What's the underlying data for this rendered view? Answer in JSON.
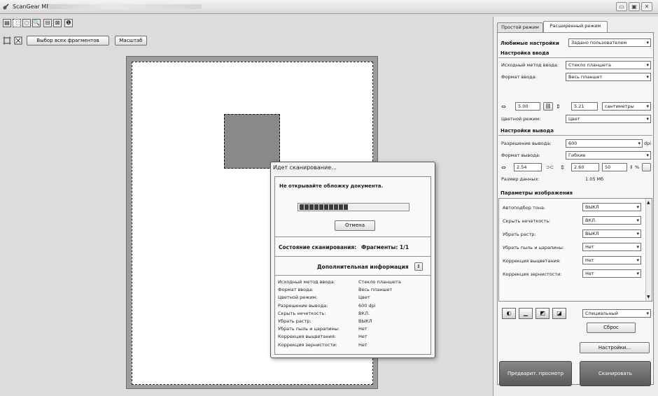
{
  "window": {
    "title": "ScanGear MF",
    "buttons": [
      "▭",
      "▣",
      "✕"
    ]
  },
  "toolbar": {
    "icons": [
      "▤",
      "⬚",
      "◌",
      "🔍",
      "⊟",
      "⊠",
      "❶"
    ],
    "select_crop_label": "Выбор всех фрагментов",
    "scale_label": "Масштаб"
  },
  "dialog": {
    "title": "Идет сканирование...",
    "warning": "Не открывайте обложку документа.",
    "cancel_label": "Отмена",
    "progress_segments_filled": 10,
    "status_label": "Состояние сканирования:",
    "status_value": "Фрагменты: 1/1",
    "more_info_label": "Дополнительная информация",
    "details": [
      {
        "label": "Исходный метод ввода:",
        "value": "Стекло планшета"
      },
      {
        "label": "Формат ввода:",
        "value": "Весь планшет"
      },
      {
        "label": "Цветной режим:",
        "value": "Цвет"
      },
      {
        "label": "Разрешение вывода:",
        "value": "600 dpi"
      },
      {
        "label": "Скрыть нечеткость:",
        "value": "ВКЛ."
      },
      {
        "label": "Убрать растр:",
        "value": "ВЫКЛ"
      },
      {
        "label": "Убрать пыль и царапины:",
        "value": "Нет"
      },
      {
        "label": "Коррекция выцветания:",
        "value": "Нет"
      },
      {
        "label": "Коррекция зернистости:",
        "value": "Нет"
      }
    ]
  },
  "right_panel": {
    "tabs": [
      "Простой режим",
      "Расширенный режим"
    ],
    "favorites_label": "Любимые настройки",
    "favorites_value": "Задано пользователем",
    "input_section": "Настройка ввода",
    "input_method_label": "Исходный метод ввода:",
    "input_method_value": "Стекло планшета",
    "input_format_label": "Формат ввода:",
    "input_format_value": "Весь планшет",
    "width_value": "5.00",
    "height_value": "5.21",
    "units_value": "сантиметры",
    "color_mode_label": "Цветной режим:",
    "color_mode_value": "Цвет",
    "output_section": "Настройки вывода",
    "output_res_label": "Разрешение вывода:",
    "output_res_value": "600",
    "output_res_unit": "dpi",
    "output_format_label": "Формат вывода:",
    "output_format_value": "Гибкие",
    "out_width_value": "2.54",
    "out_height_value": "2.60",
    "scale_percent": "50",
    "percent_sign": "%",
    "data_size_label": "Размер данных:",
    "data_size_value": "1.05 Мб",
    "image_section": "Параметры изображения",
    "image_settings": [
      {
        "label": "Автоподбор тона:",
        "value": "ВЫКЛ"
      },
      {
        "label": "Скрыть нечеткость:",
        "value": "ВКЛ."
      },
      {
        "label": "Убрать растр:",
        "value": "ВЫКЛ"
      },
      {
        "label": "Убрать пыль и царапины:",
        "value": "Нет"
      },
      {
        "label": "Коррекция выцветания:",
        "value": "Нет"
      },
      {
        "label": "Коррекция зернистости:",
        "value": "Нет"
      }
    ],
    "tone_icons": [
      "◐",
      "▁",
      "◩",
      "◪"
    ],
    "tone_preset_value": "Специальный",
    "reset_label": "Сброс",
    "settings_label": "Настройки...",
    "preview_label": "Предварит. просмотр",
    "scan_label": "Сканировать"
  }
}
